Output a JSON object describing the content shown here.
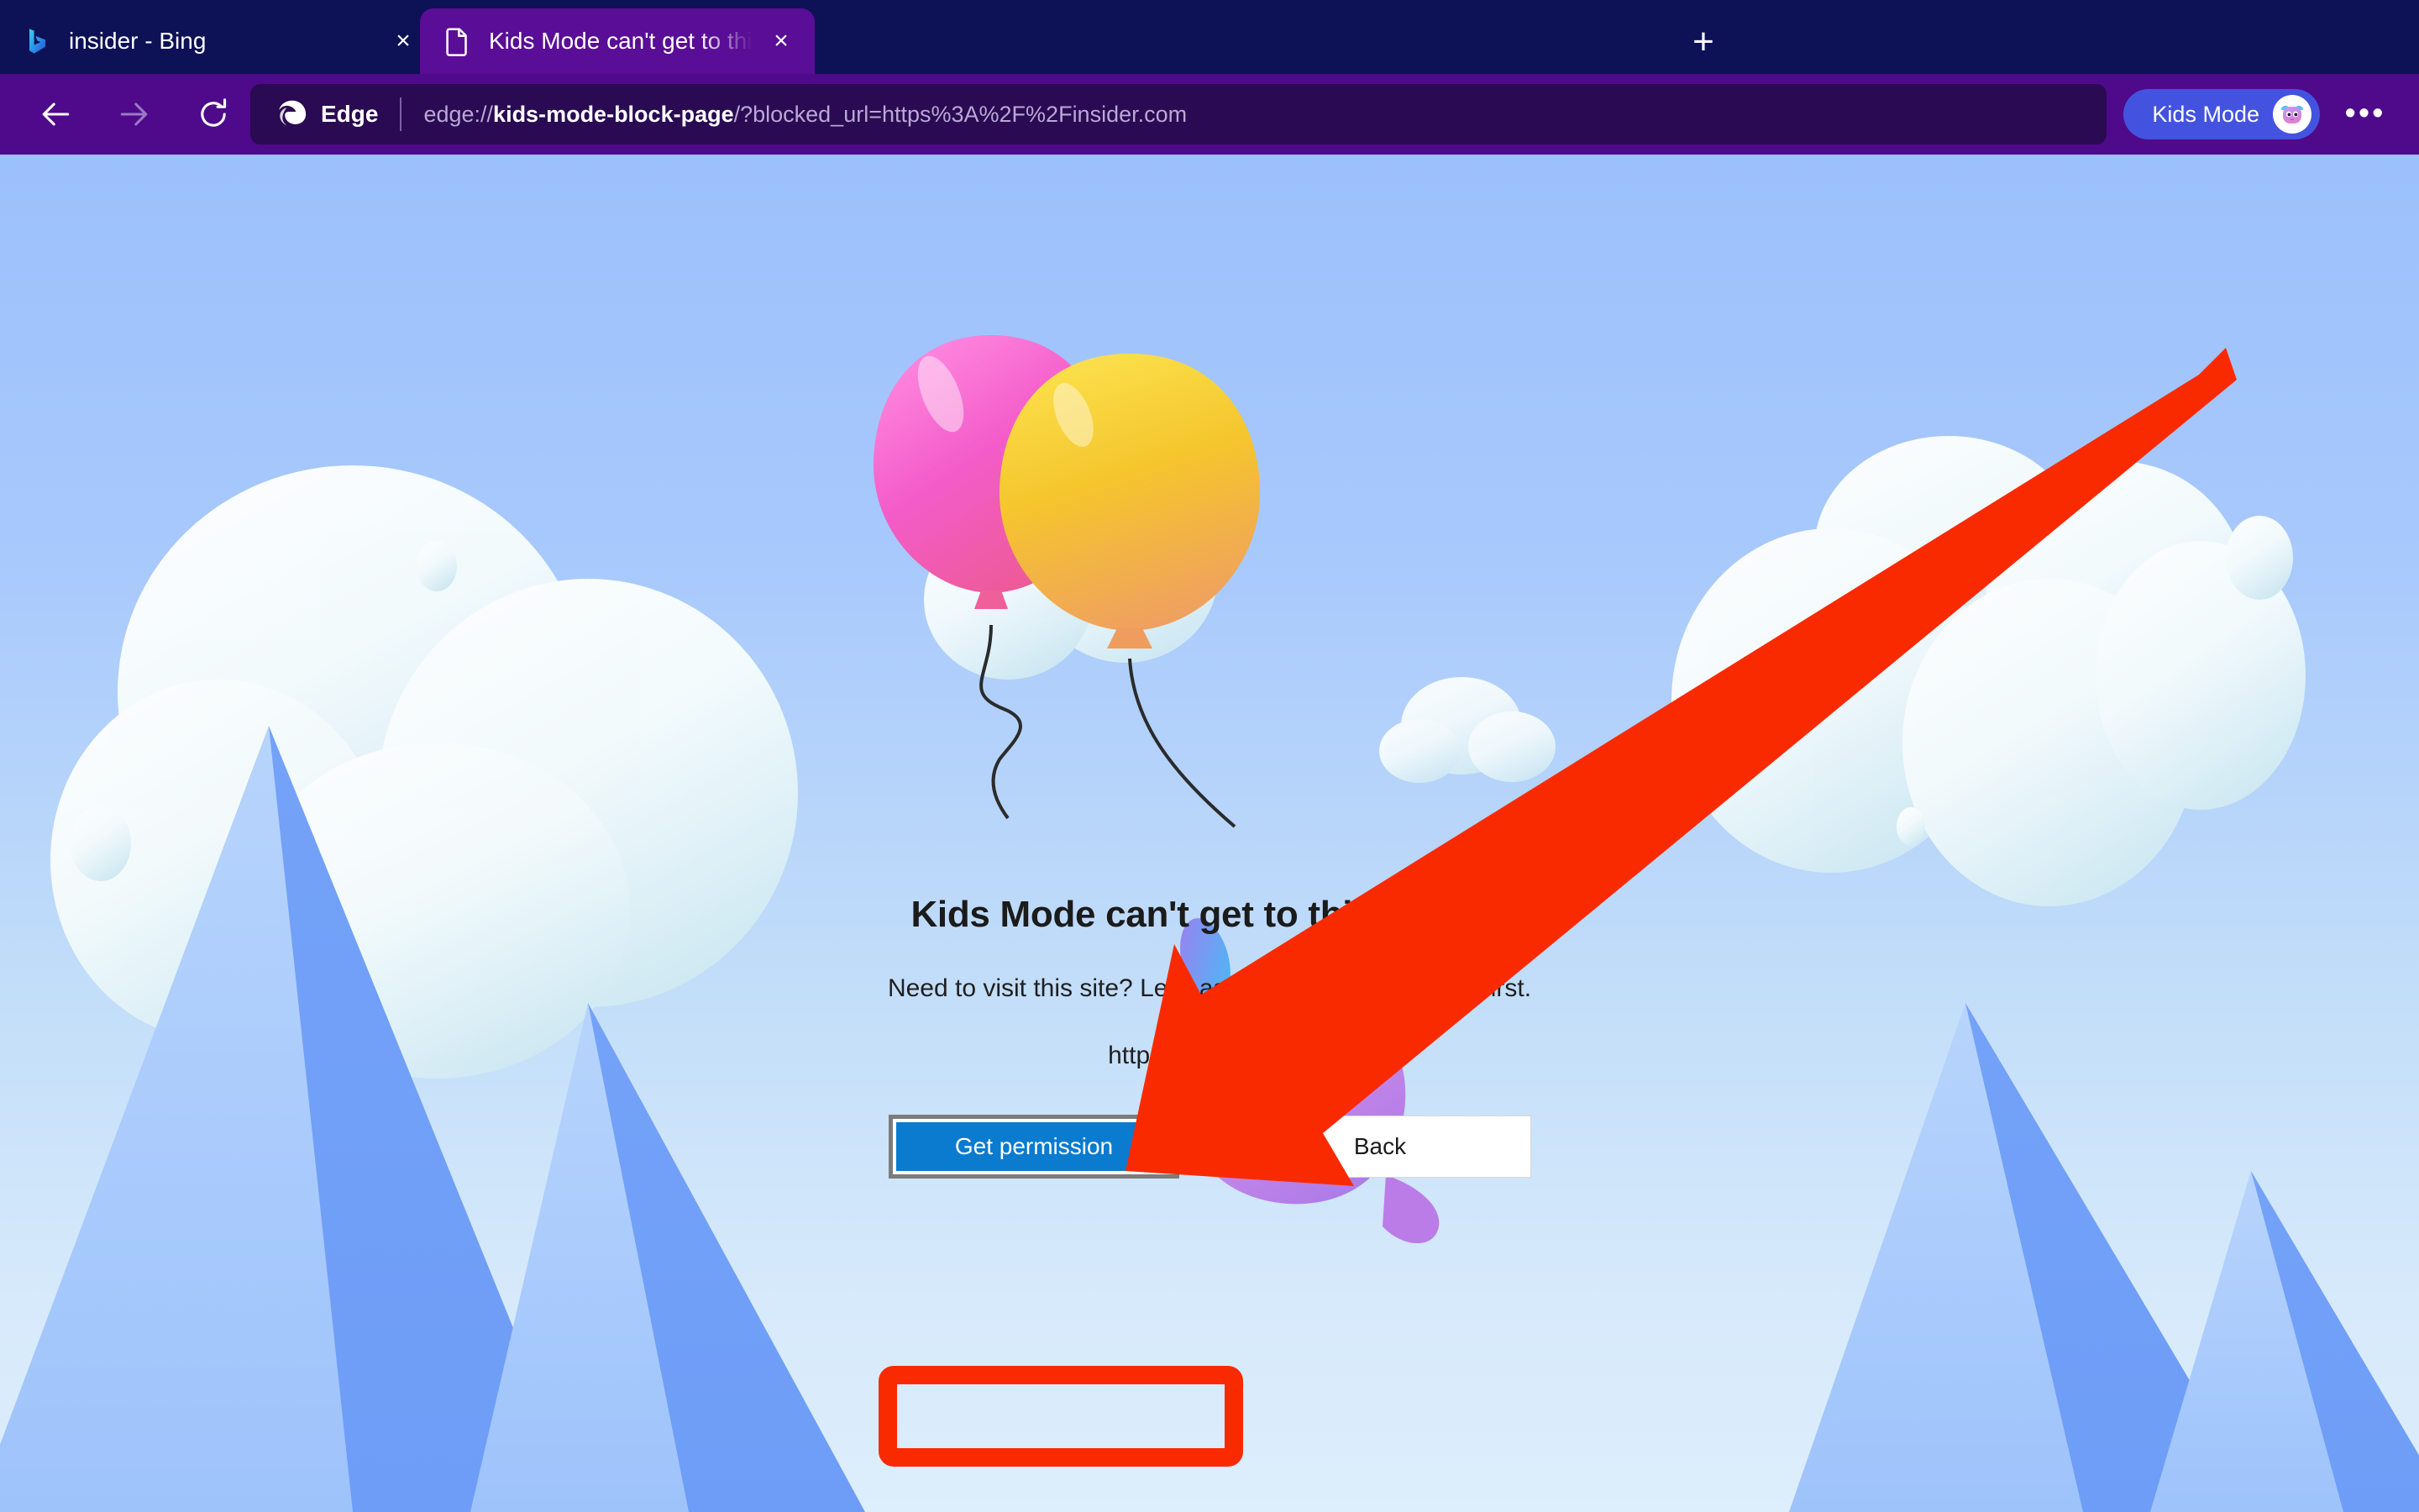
{
  "window": {
    "app": "Microsoft Edge",
    "chrome_colors": {
      "tabstrip_bg": "#0d1155",
      "toolbar_bg": "#4e0a8a",
      "active_tab_bg": "#5a0d96",
      "omnibox_bg": "#2a0a52",
      "kids_mode_pill": "#4353e0"
    }
  },
  "tabs": [
    {
      "title": "insider - Bing",
      "favicon": "bing-icon",
      "active": false,
      "close_label": "×"
    },
    {
      "title": "Kids Mode can't get to this site",
      "favicon": "page-document-icon",
      "active": true,
      "close_label": "×"
    }
  ],
  "new_tab_label": "+",
  "toolbar": {
    "back_label": "back-arrow-icon",
    "forward_label": "forward-arrow-icon",
    "refresh_label": "refresh-icon",
    "edge_brand_label": "Edge",
    "url_scheme": "edge://",
    "url_host": "kids-mode-block-page",
    "url_path": "/?blocked_url=https%3A%2F%2Finsider.com",
    "url_full": "edge://kids-mode-block-page/?blocked_url=https%3A%2F%2Finsider.com",
    "kids_mode_label": "Kids Mode",
    "more_label": "•••"
  },
  "page": {
    "headline": "Kids Mode can't get to this site yet",
    "subtext": "Need to visit this site? Let's ask an adult to unblock it first.",
    "blocked_url": "https://insider.com",
    "primary_button": "Get permission",
    "secondary_button": "Back",
    "colors": {
      "sky_top": "#9cc0fc",
      "sky_bottom": "#d7eafb",
      "mountain_light": "#a9c9fb",
      "mountain_dark": "#6c9cf7",
      "primary_button": "#0a7bce",
      "annotation_red": "#fa2a00"
    },
    "illustration": {
      "name": "kids-mode-blob-with-balloons",
      "balloon_pink": "#f15fd0",
      "balloon_yellow": "#f6cf2e",
      "balloon_orange": "#f0a35e",
      "creature_purple": "#c07be8",
      "creature_ear_blue": "#4ab6f2"
    }
  },
  "annotation": {
    "type": "arrow-and-box",
    "target": "Get permission",
    "color": "#fa2a00"
  }
}
